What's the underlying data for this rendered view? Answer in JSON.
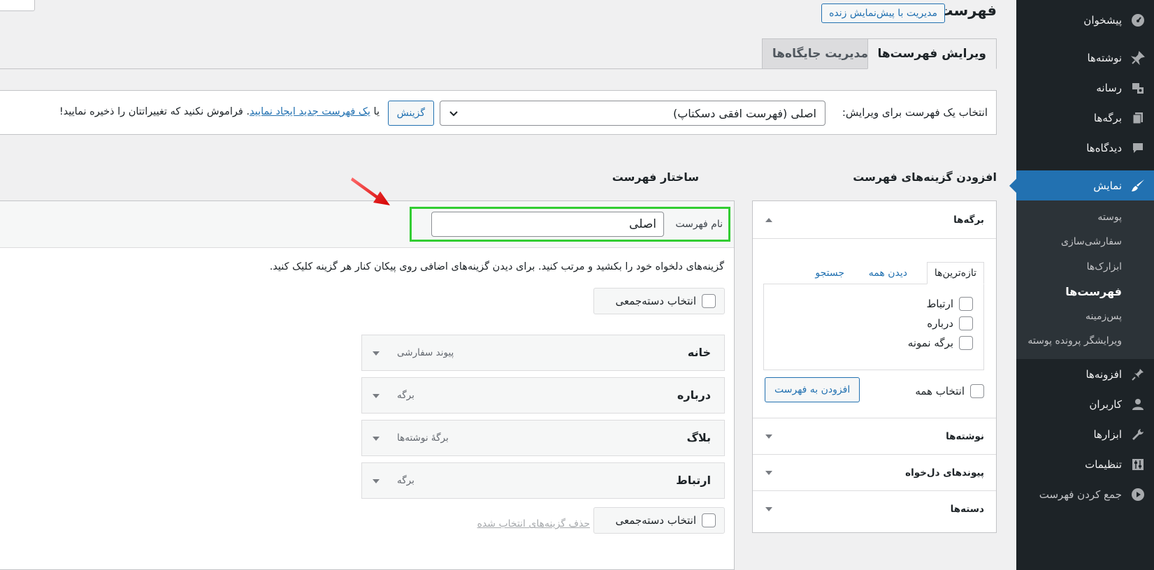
{
  "sidebar": {
    "items": [
      {
        "label": "پیشخوان",
        "icon": "dashboard-icon"
      },
      {
        "label": "نوشته‌ها",
        "icon": "pin-icon"
      },
      {
        "label": "رسانه",
        "icon": "media-icon"
      },
      {
        "label": "برگه‌ها",
        "icon": "pages-icon"
      },
      {
        "label": "دیدگاه‌ها",
        "icon": "comments-icon"
      },
      {
        "label": "نمایش",
        "icon": "appearance-brush-icon",
        "active": true
      }
    ],
    "submenu": [
      {
        "label": "پوسته"
      },
      {
        "label": "سفارشی‌سازی"
      },
      {
        "label": "ابزارک‌ها"
      },
      {
        "label": "فهرست‌ها",
        "current": true
      },
      {
        "label": "پس‌زمینه"
      },
      {
        "label": "ویرایشگر پرونده پوسته"
      }
    ],
    "items_after": [
      {
        "label": "افزونه‌ها",
        "icon": "plugins-icon"
      },
      {
        "label": "کاربران",
        "icon": "users-icon"
      },
      {
        "label": "ابزارها",
        "icon": "tools-wrench-icon"
      },
      {
        "label": "تنظیمات",
        "icon": "settings-sliders-icon"
      },
      {
        "label": "جمع کردن فهرست",
        "icon": "collapse-play-icon"
      }
    ]
  },
  "header": {
    "title": "فهرست‌ها",
    "live_preview_button": "مدیریت با پیش‌نمایش زنده"
  },
  "tabs": {
    "edit": "ویرایش فهرست‌ها",
    "locations": "مدیریت جایگاه‌ها"
  },
  "manage": {
    "label": "انتخاب یک فهرست برای ویرایش:",
    "selected_menu": "اصلی (فهرست افقی دسکتاپ)",
    "choose_button": "گزینش",
    "or_text": "یا",
    "create_link": "یک فهرست جدید ایجاد نمایید",
    "save_note": ". فراموش نکنید که تغییراتتان را ذخیره نمایید!"
  },
  "add_items": {
    "heading": "افزودن گزینه‌های فهرست",
    "pages_title": "برگه‌ها",
    "subtabs": [
      "تازه‌ترین‌ها",
      "دیدن همه",
      "جستجو"
    ],
    "pages": [
      "ارتباط",
      "درباره",
      "برگه نمونه"
    ],
    "select_all": "انتخاب همه",
    "add_button": "افزودن به فهرست",
    "other_sections": [
      "نوشته‌ها",
      "پیوندهای دل‌خواه",
      "دسته‌ها"
    ]
  },
  "structure": {
    "heading": "ساختار فهرست",
    "name_label": "نام فهرست",
    "name_value": "اصلی",
    "instructions": "گزینه‌های دلخواه خود را بکشید و مرتب کنید. برای دیدن گزینه‌های اضافی روی پیکان کنار هر گزینه کلیک کنید.",
    "bulk_select": "انتخاب دسته‌جمعی",
    "delete_selected": "حذف گزینه‌های انتخاب شده",
    "items": [
      {
        "title": "خانه",
        "type": "پیوند سفارشی"
      },
      {
        "title": "درباره",
        "type": "برگه"
      },
      {
        "title": "بلاگ",
        "type": "برگهٔ نوشته‌ها"
      },
      {
        "title": "ارتباط",
        "type": "برگه"
      }
    ]
  },
  "colors": {
    "admin_bar": "#1d2327",
    "accent": "#2271b1",
    "highlight_border": "#32cd32",
    "annotation_arrow": "#e00000"
  }
}
